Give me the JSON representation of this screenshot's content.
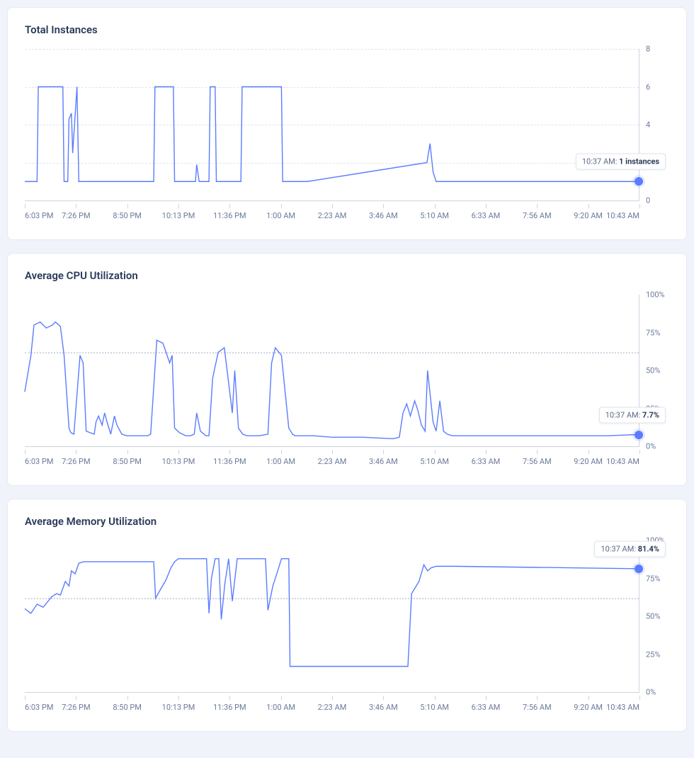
{
  "colors": {
    "line": "#5b7cff",
    "grid": "#e0e4ec",
    "axis": "#cdd4e0",
    "text": "#6b7b99",
    "title": "#2a3a5a"
  },
  "x_labels": [
    "6:03 PM",
    "7:26 PM",
    "8:50 PM",
    "10:13 PM",
    "11:36 PM",
    "1:00 AM",
    "2:23 AM",
    "3:46 AM",
    "5:10 AM",
    "6:33 AM",
    "7:56 AM",
    "9:20 AM",
    "10:43 AM"
  ],
  "chart_data": [
    {
      "id": "instances",
      "type": "line",
      "title": "Total Instances",
      "ylabel": "",
      "ylim": [
        0,
        8
      ],
      "yticks": [
        0,
        2,
        4,
        6,
        8
      ],
      "gridlines": [
        2,
        4,
        6,
        8
      ],
      "tooltip": {
        "time": "10:37 AM",
        "value_text": "1 instances",
        "value_num": 1
      },
      "x": [
        0.0,
        0.02,
        0.022,
        0.062,
        0.064,
        0.07,
        0.072,
        0.076,
        0.078,
        0.085,
        0.088,
        0.21,
        0.212,
        0.242,
        0.244,
        0.278,
        0.28,
        0.284,
        0.3,
        0.302,
        0.31,
        0.312,
        0.352,
        0.354,
        0.418,
        0.42,
        0.458,
        0.46,
        0.655,
        0.66,
        0.665,
        0.67,
        0.68,
        0.998,
        1.0
      ],
      "y": [
        1.0,
        1.0,
        6.0,
        6.0,
        1.0,
        1.0,
        4.3,
        4.6,
        2.5,
        6.0,
        1.0,
        1.0,
        6.0,
        6.0,
        1.0,
        1.0,
        1.9,
        1.0,
        1.0,
        6.0,
        6.0,
        1.0,
        1.0,
        6.0,
        6.0,
        1.0,
        1.0,
        1.0,
        2.0,
        3.0,
        1.5,
        1.0,
        1.0,
        1.0,
        1.0
      ]
    },
    {
      "id": "cpu",
      "type": "line",
      "title": "Average CPU Utilization",
      "ylabel": "",
      "ylim": [
        0,
        100
      ],
      "yticks": [
        0,
        25,
        50,
        75,
        100
      ],
      "ytick_suffix": "%",
      "gridlines_dotted": [
        62
      ],
      "tooltip": {
        "time": "10:37 AM",
        "value_text": "7.7%",
        "value_num": 7.7
      },
      "x": [
        0.0,
        0.01,
        0.015,
        0.025,
        0.035,
        0.045,
        0.05,
        0.058,
        0.064,
        0.072,
        0.075,
        0.08,
        0.09,
        0.095,
        0.1,
        0.113,
        0.116,
        0.12,
        0.126,
        0.13,
        0.134,
        0.14,
        0.146,
        0.15,
        0.158,
        0.166,
        0.176,
        0.186,
        0.2,
        0.205,
        0.215,
        0.225,
        0.236,
        0.24,
        0.244,
        0.252,
        0.262,
        0.27,
        0.276,
        0.28,
        0.286,
        0.295,
        0.3,
        0.306,
        0.315,
        0.325,
        0.338,
        0.342,
        0.348,
        0.355,
        0.362,
        0.37,
        0.382,
        0.396,
        0.402,
        0.408,
        0.418,
        0.43,
        0.436,
        0.44,
        0.448,
        0.458,
        0.47,
        0.5,
        0.55,
        0.6,
        0.61,
        0.616,
        0.622,
        0.628,
        0.635,
        0.64,
        0.646,
        0.652,
        0.656,
        0.66,
        0.665,
        0.67,
        0.676,
        0.682,
        0.688,
        0.696,
        0.7,
        0.708,
        0.75,
        0.8,
        0.85,
        0.9,
        0.95,
        0.996,
        1.0
      ],
      "y": [
        36,
        60,
        80,
        82,
        78,
        80,
        82,
        79,
        60,
        12,
        9,
        8,
        60,
        55,
        10,
        8,
        16,
        20,
        14,
        22,
        16,
        8,
        20,
        14,
        8,
        7,
        7,
        7,
        7,
        8,
        70,
        68,
        55,
        60,
        12,
        9,
        7,
        7,
        8,
        22,
        10,
        7,
        7,
        45,
        62,
        65,
        22,
        50,
        12,
        8,
        7,
        7,
        7,
        8,
        55,
        65,
        60,
        12,
        8,
        7,
        7,
        7,
        7,
        6,
        6,
        5,
        6,
        22,
        28,
        20,
        30,
        24,
        14,
        10,
        50,
        35,
        16,
        10,
        30,
        10,
        8,
        7,
        7,
        7,
        7,
        7,
        7,
        7,
        7,
        7.7,
        7.7
      ]
    },
    {
      "id": "memory",
      "type": "line",
      "title": "Average Memory Utilization",
      "ylabel": "",
      "ylim": [
        0,
        100
      ],
      "yticks": [
        0,
        25,
        50,
        75,
        100
      ],
      "ytick_suffix": "%",
      "gridlines_dotted": [
        62
      ],
      "tooltip": {
        "time": "10:37 AM",
        "value_text": "81.4%",
        "value_num": 81.4
      },
      "x": [
        0.0,
        0.01,
        0.02,
        0.03,
        0.044,
        0.052,
        0.058,
        0.066,
        0.072,
        0.076,
        0.082,
        0.088,
        0.096,
        0.21,
        0.213,
        0.22,
        0.23,
        0.238,
        0.244,
        0.25,
        0.268,
        0.296,
        0.3,
        0.304,
        0.31,
        0.316,
        0.32,
        0.326,
        0.332,
        0.338,
        0.346,
        0.37,
        0.392,
        0.396,
        0.404,
        0.412,
        0.418,
        0.43,
        0.432,
        0.446,
        0.448,
        0.46,
        0.6,
        0.624,
        0.63,
        0.642,
        0.65,
        0.656,
        0.662,
        0.67,
        0.68,
        0.7,
        0.996,
        1.0
      ],
      "y": [
        55,
        52,
        58,
        56,
        63,
        65,
        64,
        73,
        70,
        80,
        78,
        85,
        86,
        86,
        62,
        67,
        74,
        82,
        86,
        88,
        88,
        88,
        52,
        75,
        88,
        88,
        48,
        72,
        88,
        60,
        88,
        88,
        88,
        54,
        70,
        80,
        88,
        88,
        17,
        17,
        17,
        17,
        17,
        17,
        65,
        73,
        84,
        80,
        82,
        83,
        83,
        83,
        81.4,
        81.4
      ]
    }
  ]
}
